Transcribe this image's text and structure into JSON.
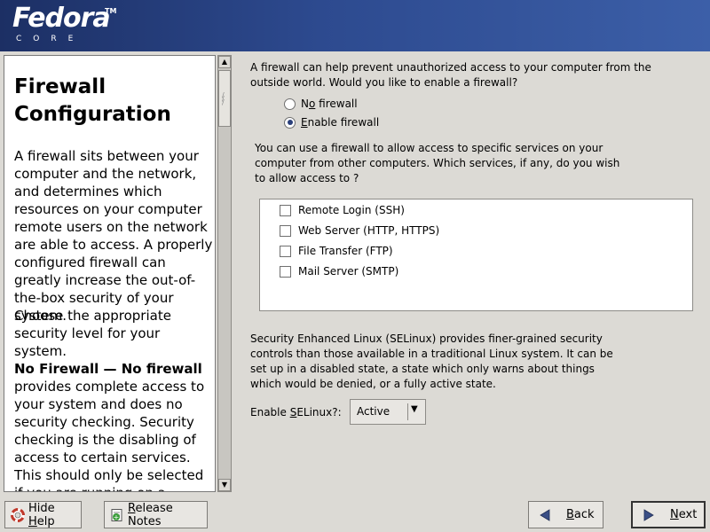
{
  "brand": {
    "name": "Fedora",
    "tm": "TM",
    "subtitle": "CORE"
  },
  "help": {
    "title": "Firewall Configuration",
    "p1": "A firewall sits between your computer and the network, and determines which resources on your computer remote users on the network are able to access. A properly configured firewall can greatly increase the out-of-the-box security of your system.",
    "p2": "Choose the appropriate security level for your system.",
    "p3_bold": "No Firewall — No firewall",
    "p3_rest": " provides complete access to your system and does no security checking. Security checking is the disabling of access to certain services. This should only be selected if you are running on a trusted"
  },
  "firewall": {
    "question": "A firewall can help prevent unauthorized access to your computer from the outside world.  Would you like to enable a firewall?",
    "options": [
      {
        "pre": "N",
        "ul": "o",
        "post": " firewall",
        "selected": false
      },
      {
        "pre": "",
        "ul": "E",
        "post": "nable firewall",
        "selected": true
      }
    ]
  },
  "services": {
    "question": "You can use a firewall to allow access to specific services on your computer from other computers. Which services, if any, do you wish to allow access to ?",
    "items": [
      {
        "label": "Remote Login (SSH)",
        "checked": false
      },
      {
        "label": "Web Server (HTTP, HTTPS)",
        "checked": false
      },
      {
        "label": "File Transfer (FTP)",
        "checked": false
      },
      {
        "label": "Mail Server (SMTP)",
        "checked": false
      }
    ]
  },
  "selinux": {
    "description": "Security Enhanced Linux (SELinux) provides finer-grained security controls than those available in a traditional Linux system.  It can be set up in a disabled state, a state which only warns about things which would be denied, or a fully active state.",
    "label_pre": "Enable ",
    "label_ul": "S",
    "label_post": "ELinux?:",
    "value": "Active"
  },
  "buttons": {
    "hide_help_pre": "Hide ",
    "hide_help_ul": "H",
    "hide_help_post": "elp",
    "release_notes_ul": "R",
    "release_notes_post": "elease Notes",
    "back_ul": "B",
    "back_post": "ack",
    "next_ul": "N",
    "next_post": "ext"
  },
  "icons": {
    "hide_help": "lifebuoy-icon",
    "release_notes": "notes-icon",
    "back": "left-arrow-icon",
    "next": "right-arrow-icon"
  },
  "colors": {
    "banner": "#2d4a8f",
    "background": "#dcdad5",
    "radio_dot": "#2a3f7a"
  }
}
